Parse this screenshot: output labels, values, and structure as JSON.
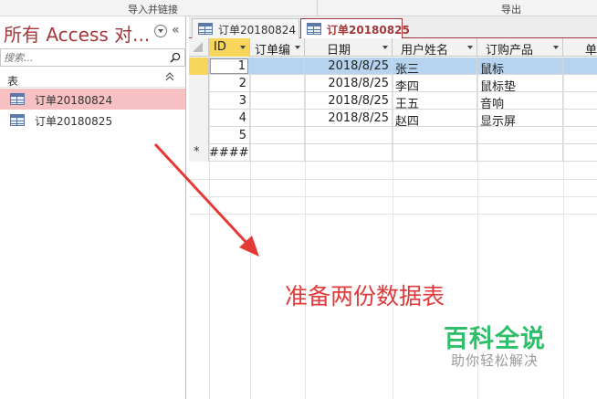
{
  "ribbon": {
    "group_import": "导入并链接",
    "group_export": "导出"
  },
  "nav": {
    "title": "所有 Access 对...",
    "collapse_glyph": "«",
    "search_placeholder": "搜索...",
    "group_label": "表",
    "group_chevron": "⌃",
    "items": [
      {
        "label": "订单20180824",
        "icon": "table-icon",
        "active": true
      },
      {
        "label": "订单20180825",
        "icon": "table-icon",
        "active": false
      }
    ]
  },
  "tabs": [
    {
      "label": "订单20180824",
      "active": false
    },
    {
      "label": "订单20180825",
      "active": true
    }
  ],
  "datasheet": {
    "columns": [
      "ID",
      "订单编",
      "日期",
      "用户姓名",
      "订购产品",
      "单"
    ],
    "rows": [
      {
        "id": "1",
        "order_no": "",
        "date": "2018/8/25",
        "name": "张三",
        "product": "鼠标",
        "selected": true
      },
      {
        "id": "2",
        "order_no": "",
        "date": "2018/8/25",
        "name": "李四",
        "product": "鼠标垫",
        "selected": false
      },
      {
        "id": "3",
        "order_no": "",
        "date": "2018/8/25",
        "name": "王五",
        "product": "音响",
        "selected": false
      },
      {
        "id": "4",
        "order_no": "",
        "date": "2018/8/25",
        "name": "赵四",
        "product": "显示屏",
        "selected": false
      },
      {
        "id": "5",
        "order_no": "",
        "date": "",
        "name": "",
        "product": "",
        "selected": false
      }
    ],
    "new_row": {
      "marker": "*",
      "id": "####"
    }
  },
  "annotation": {
    "text": "准备两份数据表",
    "color": "#e03a3a"
  },
  "watermark": {
    "main": "百科全说",
    "sub": "助你轻松解决"
  },
  "colors": {
    "access_accent": "#a4373a",
    "selection": "#b6d4ef",
    "header_active": "#f8d55b",
    "nav_active": "#f7c1c3"
  }
}
